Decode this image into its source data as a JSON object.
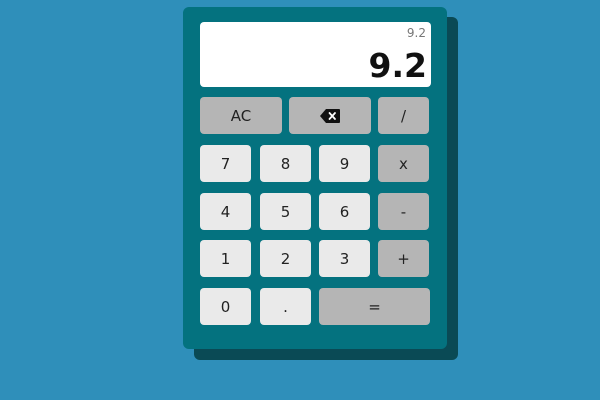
{
  "display": {
    "history": "9.2",
    "value": "9.2"
  },
  "keys": {
    "clear": "AC",
    "backspace_icon": "backspace-icon",
    "divide": "/",
    "seven": "7",
    "eight": "8",
    "nine": "9",
    "multiply": "x",
    "four": "4",
    "five": "5",
    "six": "6",
    "subtract": "-",
    "one": "1",
    "two": "2",
    "three": "3",
    "add": "+",
    "zero": "0",
    "decimal": ".",
    "equals": "="
  },
  "colors": {
    "background": "#2f8fba",
    "body": "#04727f",
    "shadow": "#0a4a55",
    "display": "#ffffff",
    "number_key": "#eaeaea",
    "operator_key": "#b5b5b5"
  }
}
